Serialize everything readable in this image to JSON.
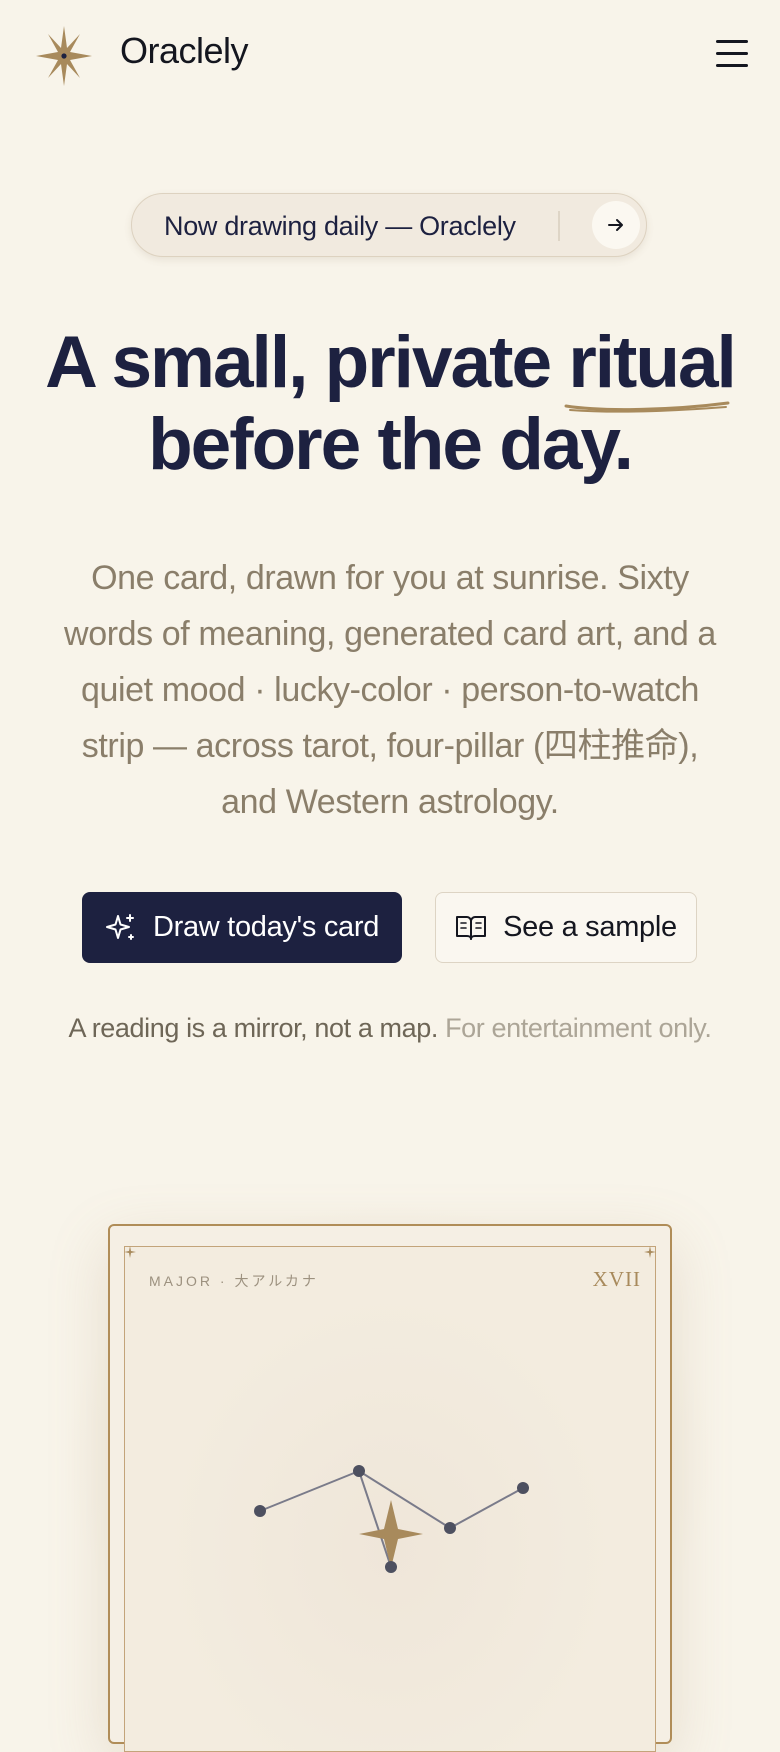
{
  "header": {
    "brand": "Oraclely",
    "logo_icon": "star-burst-icon",
    "menu_icon": "hamburger-menu-icon"
  },
  "announcement": {
    "text": "Now drawing daily — Oraclely",
    "arrow_icon": "arrow-right-icon"
  },
  "hero": {
    "title_part1": "A small, private ",
    "title_highlight": "ritual",
    "title_line2": "before the day.",
    "lead": "One card, drawn for you at sunrise. Sixty words of meaning, generated card art, and a quiet mood · lucky-color · person-to-watch strip — across tarot, four-pillar (四柱推命), and Western astrology."
  },
  "actions": {
    "primary_label": "Draw today's card",
    "primary_icon": "sparkles-icon",
    "secondary_label": "See a sample",
    "secondary_icon": "open-book-icon"
  },
  "disclaimer": {
    "main": "A reading is a mirror, not a map.",
    "muted": "For entertainment only."
  },
  "card": {
    "label": "MAJOR · 大アルカナ",
    "numeral": "XVII"
  },
  "colors": {
    "background": "#f8f4ea",
    "navy": "#1d2140",
    "gold": "#a88a5c",
    "muted_text": "#8a7e6a"
  }
}
